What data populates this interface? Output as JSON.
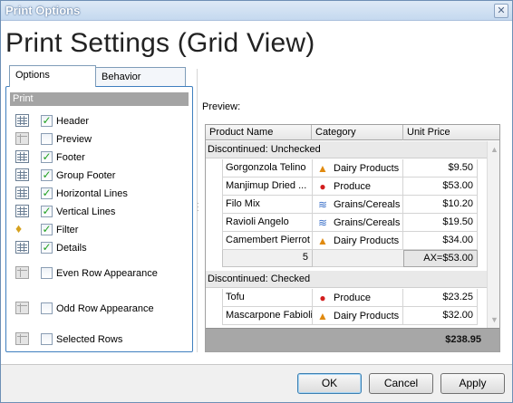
{
  "window": {
    "title": "Print Options",
    "close_symbol": "✕"
  },
  "heading": "Print Settings (Grid View)",
  "tabs": [
    {
      "label": "Options",
      "active": true
    },
    {
      "label": "Behavior",
      "active": false
    }
  ],
  "print_section": {
    "header": "Print",
    "options": [
      {
        "label": "Header",
        "checked": true,
        "icon": "header-grid-icon"
      },
      {
        "label": "Preview",
        "checked": false,
        "icon": "preview-grid-icon"
      },
      {
        "label": "Footer",
        "checked": true,
        "icon": "footer-grid-icon"
      },
      {
        "label": "Group Footer",
        "checked": true,
        "icon": "group-footer-grid-icon"
      },
      {
        "label": "Horizontal Lines",
        "checked": true,
        "icon": "horizontal-lines-icon"
      },
      {
        "label": "Vertical Lines",
        "checked": true,
        "icon": "vertical-lines-icon"
      },
      {
        "label": "Filter",
        "checked": true,
        "icon": "filter-icon"
      },
      {
        "label": "Details",
        "checked": true,
        "icon": "details-grid-icon"
      },
      {
        "label": "Even Row Appearance",
        "checked": false,
        "icon": "even-row-icon"
      },
      {
        "label": "Odd Row Appearance",
        "checked": false,
        "icon": "odd-row-icon"
      },
      {
        "label": "Selected Rows",
        "checked": false,
        "icon": "selected-rows-icon"
      }
    ]
  },
  "preview": {
    "label": "Preview:",
    "columns": [
      "Product Name",
      "Category",
      "Unit Price"
    ],
    "groups": [
      {
        "title": "Discontinued: Unchecked",
        "rows": [
          {
            "name": "Gorgonzola Telino",
            "category": "Dairy Products",
            "category_icon": "cheese-icon",
            "price": "$9.50"
          },
          {
            "name": "Manjimup Dried ...",
            "category": "Produce",
            "category_icon": "apple-icon",
            "price": "$53.00"
          },
          {
            "name": "Filo Mix",
            "category": "Grains/Cereals",
            "category_icon": "grain-icon",
            "price": "$10.20"
          },
          {
            "name": "Ravioli Angelo",
            "category": "Grains/Cereals",
            "category_icon": "grain-icon",
            "price": "$19.50"
          },
          {
            "name": "Camembert Pierrot",
            "category": "Dairy Products",
            "category_icon": "cheese-icon",
            "price": "$34.00"
          }
        ],
        "summary_count": "5",
        "summary_max": "AX=$53.00"
      },
      {
        "title": "Discontinued: Checked",
        "rows": [
          {
            "name": "Tofu",
            "category": "Produce",
            "category_icon": "apple-icon",
            "price": "$23.25"
          },
          {
            "name": "Mascarpone Fabioli",
            "category": "Dairy Products",
            "category_icon": "cheese-icon",
            "price": "$32.00"
          }
        ]
      }
    ],
    "footer_total": "$238.95"
  },
  "buttons": {
    "ok": "OK",
    "cancel": "Cancel",
    "apply": "Apply"
  }
}
